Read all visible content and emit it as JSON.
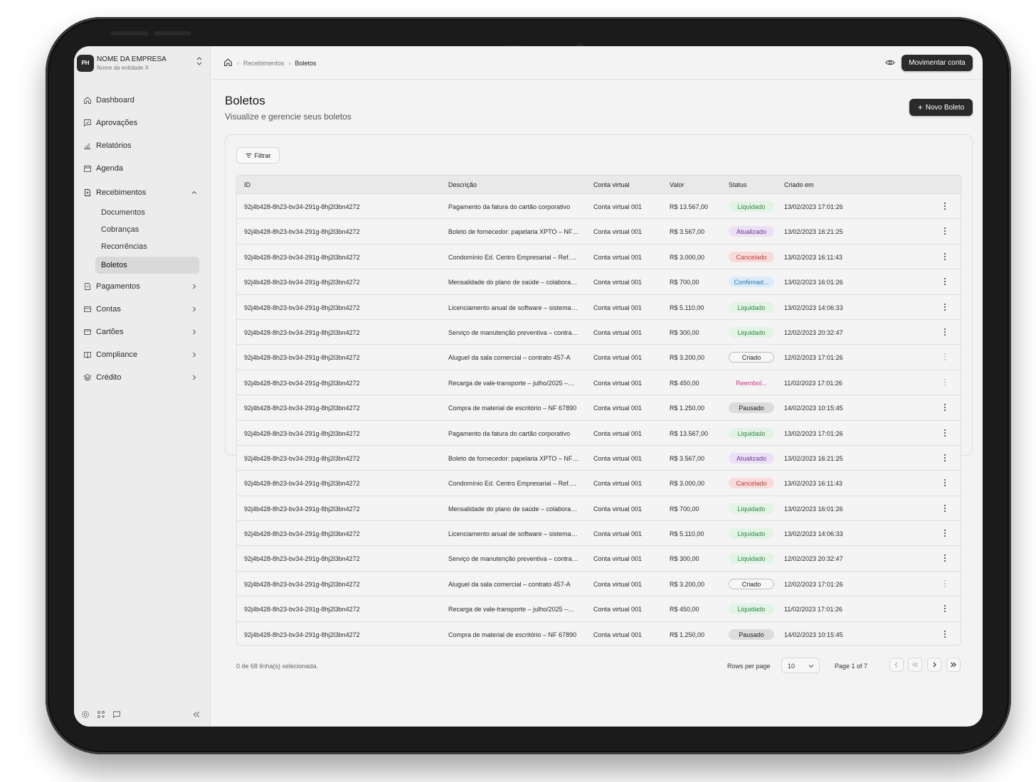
{
  "org": {
    "logo": "PH",
    "name": "NOME DA EMPRESA",
    "sub": "Nome da entidade X"
  },
  "nav": [
    {
      "label": "Dashboard",
      "icon": "home-icon"
    },
    {
      "label": "Aprovações",
      "icon": "message-check-icon"
    },
    {
      "label": "Relatórios",
      "icon": "bar-chart-icon"
    },
    {
      "label": "Agenda",
      "icon": "calendar-icon"
    },
    {
      "label": "Recebimentos",
      "icon": "file-icon"
    },
    {
      "label": "Pagamentos",
      "icon": "file-dollar-icon"
    },
    {
      "label": "Contas",
      "icon": "wallet-icon"
    },
    {
      "label": "Cartões",
      "icon": "credit-card-icon"
    },
    {
      "label": "Compliance",
      "icon": "book-icon"
    },
    {
      "label": "Crédito",
      "icon": "layers-icon"
    }
  ],
  "subnav": [
    "Documentos",
    "Cobranças",
    "Recorrências",
    "Boletos"
  ],
  "breadcrumb": {
    "level1": "Recebimentos",
    "level2": "Boletos"
  },
  "top": {
    "move_account": "Movimentar conta"
  },
  "page": {
    "title": "Boletos",
    "subtitle": "Visualize e gerencie seus boletos",
    "new_button": "Novo Boleto",
    "filter": "Filtrar"
  },
  "table": {
    "headers": [
      "ID",
      "Descrição",
      "Conta virtual",
      "Valor",
      "Status",
      "Criado em"
    ],
    "rows": [
      {
        "id": "92j4b428-8h23-bv34-291g-8hj2l3bn4272",
        "desc": "Pagamento da fatura do cartão corporativo",
        "conta": "Conta virtual 001",
        "valor": "R$ 13.567,00",
        "status": "Liquidado",
        "date": "13/02/2023 17:01:26"
      },
      {
        "id": "92j4b428-8h23-bv34-291g-8hj2l3bn4272",
        "desc": "Boleto de fornecedor: papelaria XPTO – NF…",
        "conta": "Conta virtual 001",
        "valor": "R$ 3.567,00",
        "status": "Atualizado",
        "date": "13/02/2023 16:21:25"
      },
      {
        "id": "92j4b428-8h23-bv34-291g-8hj2l3bn4272",
        "desc": "Condomínio Ed. Centro Empresarial – Ref.…",
        "conta": "Conta virtual 001",
        "valor": "R$ 3.000,00",
        "status": "Cancelado",
        "date": "13/02/2023 16:11:43"
      },
      {
        "id": "92j4b428-8h23-bv34-291g-8hj2l3bn4272",
        "desc": "Mensalidade do plano de saúde – colabora…",
        "conta": "Conta virtual 001",
        "valor": "R$ 700,00",
        "status": "Confirmad...",
        "date": "13/02/2023 16:01:26"
      },
      {
        "id": "92j4b428-8h23-bv34-291g-8hj2l3bn4272",
        "desc": "Licenciamento anual de software – sistema…",
        "conta": "Conta virtual 001",
        "valor": "R$ 5.110,00",
        "status": "Liquidado",
        "date": "13/02/2023 14:06:33"
      },
      {
        "id": "92j4b428-8h23-bv34-291g-8hj2l3bn4272",
        "desc": "Serviço de manutenção preventiva – contra…",
        "conta": "Conta virtual 001",
        "valor": "R$ 300,00",
        "status": "Liquidado",
        "date": "12/02/2023 20:32:47"
      },
      {
        "id": "92j4b428-8h23-bv34-291g-8hj2l3bn4272",
        "desc": "Aluguel da sala comercial – contrato 457-A",
        "conta": "Conta virtual 001",
        "valor": "R$ 3.200,00",
        "status": "Criado",
        "date": "12/02/2023 17:01:26"
      },
      {
        "id": "92j4b428-8h23-bv34-291g-8hj2l3bn4272",
        "desc": "Recarga de vale-transporte – julho/2025 –…",
        "conta": "Conta virtual 001",
        "valor": "R$ 450,00",
        "status": "Reembol...",
        "date": "11/02/2023 17:01:26"
      },
      {
        "id": "92j4b428-8h23-bv34-291g-8hj2l3bn4272",
        "desc": "Compra de material de escritório – NF 67890",
        "conta": "Conta virtual 001",
        "valor": "R$ 1.250,00",
        "status": "Pausado",
        "date": "14/02/2023 10:15:45"
      },
      {
        "id": "92j4b428-8h23-bv34-291g-8hj2l3bn4272",
        "desc": "Pagamento da fatura do cartão corporativo",
        "conta": "Conta virtual 001",
        "valor": "R$ 13.567,00",
        "status": "Liquidado",
        "date": "13/02/2023 17:01:26"
      },
      {
        "id": "92j4b428-8h23-bv34-291g-8hj2l3bn4272",
        "desc": "Boleto de fornecedor: papelaria XPTO – NF…",
        "conta": "Conta virtual 001",
        "valor": "R$ 3.567,00",
        "status": "Atualizado",
        "date": "13/02/2023 16:21:25"
      },
      {
        "id": "92j4b428-8h23-bv34-291g-8hj2l3bn4272",
        "desc": "Condomínio Ed. Centro Empresarial – Ref.…",
        "conta": "Conta virtual 001",
        "valor": "R$ 3.000,00",
        "status": "Cancelado",
        "date": "13/02/2023 16:11:43"
      },
      {
        "id": "92j4b428-8h23-bv34-291g-8hj2l3bn4272",
        "desc": "Mensalidade do plano de saúde – colabora…",
        "conta": "Conta virtual 001",
        "valor": "R$ 700,00",
        "status": "Liquidado",
        "date": "13/02/2023 16:01:26"
      },
      {
        "id": "92j4b428-8h23-bv34-291g-8hj2l3bn4272",
        "desc": "Licenciamento anual de software – sistema…",
        "conta": "Conta virtual 001",
        "valor": "R$ 5.110,00",
        "status": "Liquidado",
        "date": "13/02/2023 14:06:33"
      },
      {
        "id": "92j4b428-8h23-bv34-291g-8hj2l3bn4272",
        "desc": "Serviço de manutenção preventiva – contra…",
        "conta": "Conta virtual 001",
        "valor": "R$ 300,00",
        "status": "Liquidado",
        "date": "12/02/2023 20:32:47"
      },
      {
        "id": "92j4b428-8h23-bv34-291g-8hj2l3bn4272",
        "desc": "Aluguel da sala comercial – contrato 457-A",
        "conta": "Conta virtual 001",
        "valor": "R$ 3.200,00",
        "status": "Criado",
        "date": "12/02/2023 17:01:26"
      },
      {
        "id": "92j4b428-8h23-bv34-291g-8hj2l3bn4272",
        "desc": "Recarga de vale-transporte – julho/2025 –…",
        "conta": "Conta virtual 001",
        "valor": "R$ 450,00",
        "status": "Liquidado",
        "date": "11/02/2023 17:01:26"
      },
      {
        "id": "92j4b428-8h23-bv34-291g-8hj2l3bn4272",
        "desc": "Compra de material de escritório – NF 67890",
        "conta": "Conta virtual 001",
        "valor": "R$ 1.250,00",
        "status": "Pausado",
        "date": "14/02/2023 10:15:45"
      }
    ]
  },
  "status_colors": {
    "Liquidado": {
      "bg": "#e3f3e6",
      "fg": "#2f8a45"
    },
    "Atualizado": {
      "bg": "#ece0f5",
      "fg": "#6b3a9a"
    },
    "Cancelado": {
      "bg": "#f8dcdc",
      "fg": "#c23a3a"
    },
    "Confirmad...": {
      "bg": "#dcecf8",
      "fg": "#2f75b5"
    },
    "Criado": {
      "bg": "#f7f7f7",
      "fg": "#222222",
      "border": "#bdbdbd"
    },
    "Reembol...": {
      "bg": "#f3f3f3",
      "fg": "#d0388a"
    },
    "Pausado": {
      "bg": "#dcdcdc",
      "fg": "#222222"
    }
  },
  "footer": {
    "selection": "0 de 68 linha(s) selecionada.",
    "rows_per_page_label": "Rows per page",
    "rows_per_page": "10",
    "page_info": "Page 1 of 7"
  }
}
